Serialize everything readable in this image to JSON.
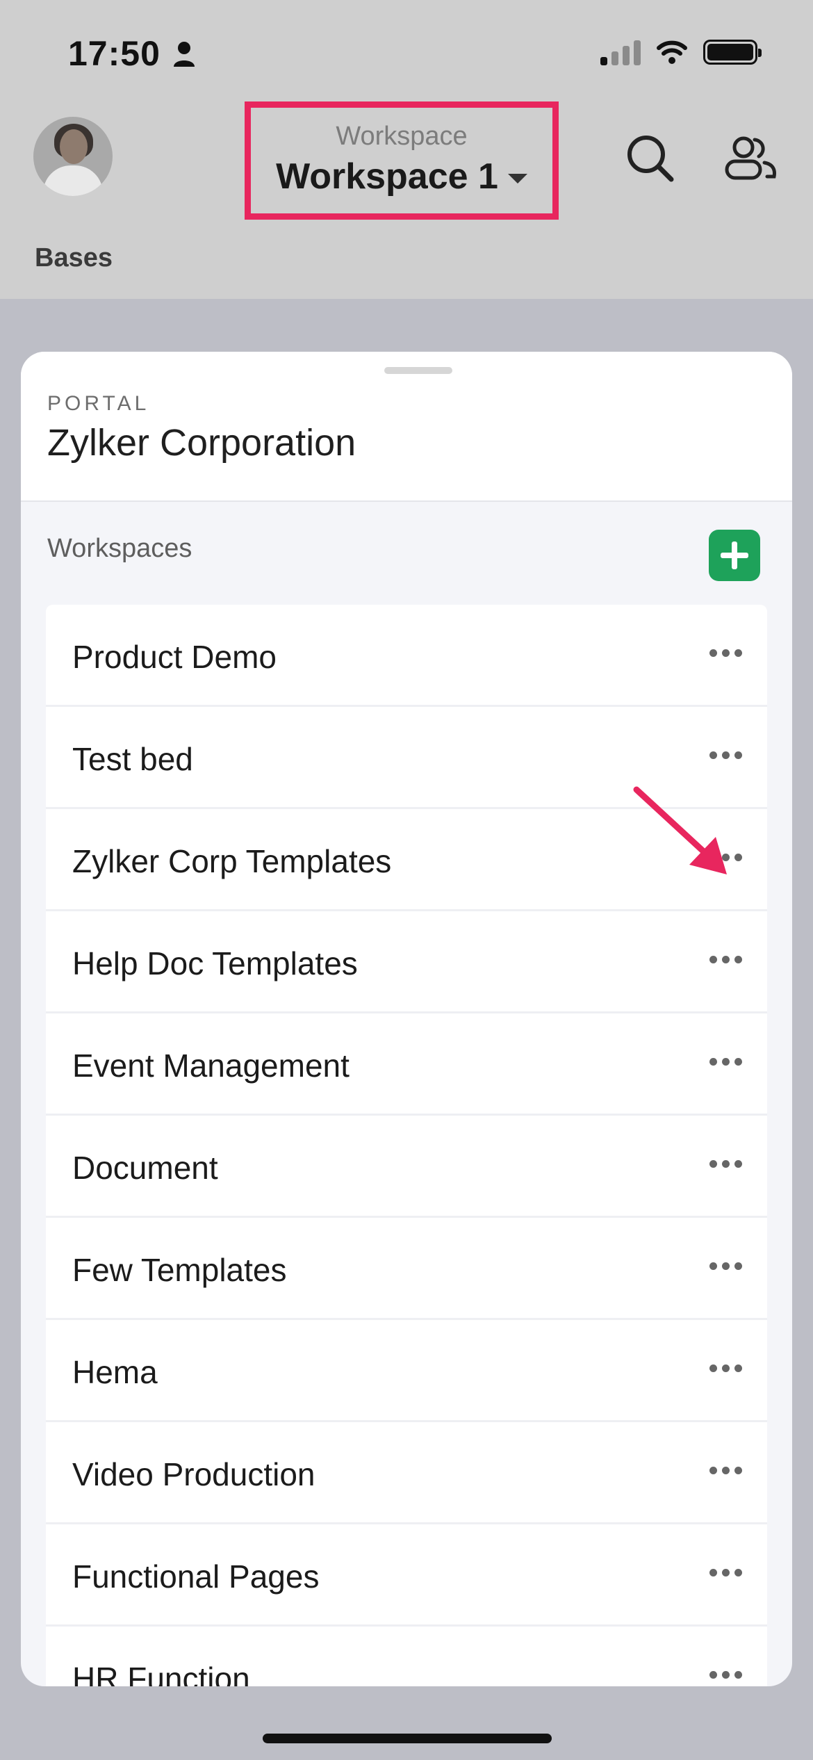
{
  "status_bar": {
    "time": "17:50",
    "icons": [
      "person-icon",
      "cellular-signal-icon",
      "wifi-icon",
      "battery-icon"
    ]
  },
  "header": {
    "avatar_icon": "user-avatar",
    "workspace_caption": "Workspace",
    "workspace_name": "Workspace 1",
    "search_icon": "search-icon",
    "users_icon": "users-icon",
    "highlight_color": "#e8265e"
  },
  "bases_label": "Bases",
  "sheet": {
    "portal_label": "PORTAL",
    "portal_name": "Zylker Corporation",
    "workspaces_label": "Workspaces",
    "add_button_color": "#1ea25a",
    "items": [
      {
        "label": "Product Demo"
      },
      {
        "label": "Test bed"
      },
      {
        "label": "Zylker Corp Templates"
      },
      {
        "label": "Help Doc Templates"
      },
      {
        "label": "Event Management"
      },
      {
        "label": "Document"
      },
      {
        "label": "Few Templates"
      },
      {
        "label": "Hema"
      },
      {
        "label": "Video Production"
      },
      {
        "label": "Functional Pages"
      },
      {
        "label": "HR Function"
      }
    ]
  }
}
